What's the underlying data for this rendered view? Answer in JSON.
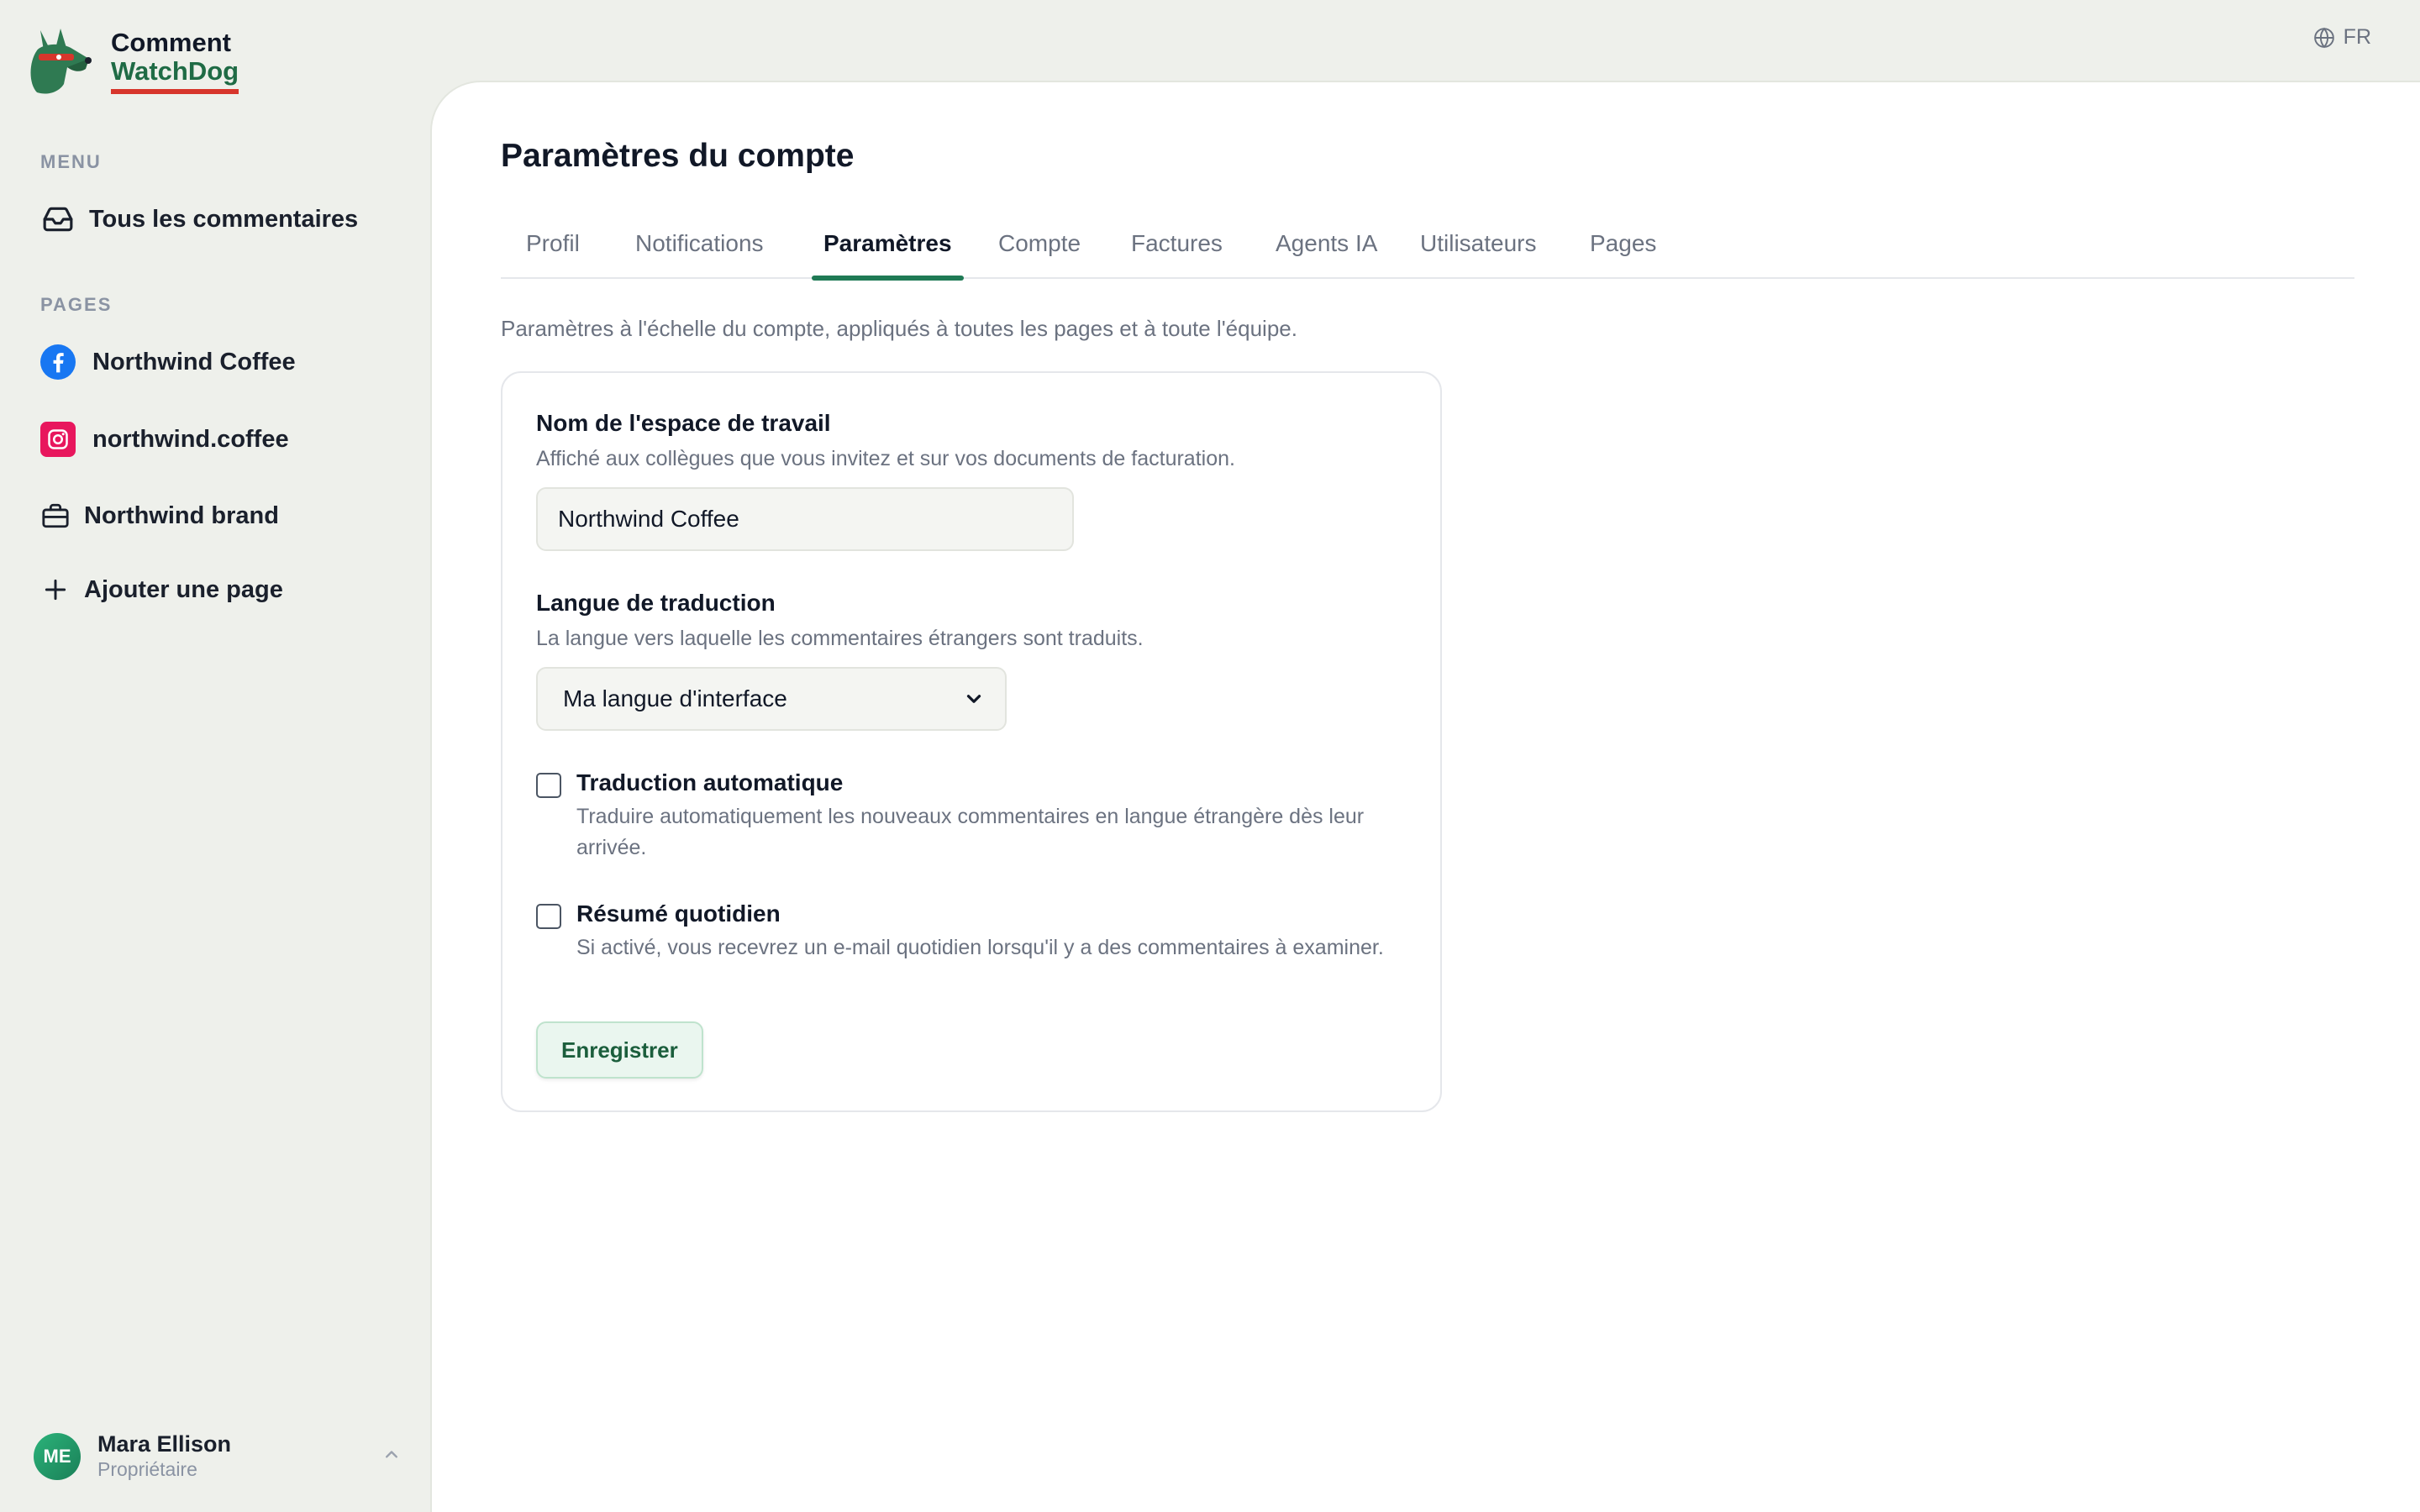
{
  "brand": {
    "line1": "Comment",
    "line2": "WatchDog",
    "accent": "#d7362c",
    "green": "#1f6b45"
  },
  "topbar": {
    "language": "FR",
    "language_icon": "globe-icon"
  },
  "sidebar": {
    "menu_label": "MENU",
    "menu_items": [
      {
        "label": "Tous les commentaires",
        "icon": "inbox-icon"
      }
    ],
    "pages_label": "PAGES",
    "pages": [
      {
        "label": "Northwind Coffee",
        "icon": "facebook-icon"
      },
      {
        "label": "northwind.coffee",
        "icon": "instagram-icon"
      },
      {
        "label": "Northwind brand",
        "icon": "briefcase-icon"
      },
      {
        "label": "Ajouter une page",
        "icon": "plus-icon"
      }
    ],
    "user": {
      "initials": "ME",
      "name": "Mara Ellison",
      "role": "Propriétaire"
    }
  },
  "main": {
    "title": "Paramètres du compte",
    "tabs": [
      {
        "label": "Profil",
        "active": false
      },
      {
        "label": "Notifications",
        "active": false
      },
      {
        "label": "Paramètres",
        "active": true
      },
      {
        "label": "Compte",
        "active": false
      },
      {
        "label": "Factures",
        "active": false
      },
      {
        "label": "Agents IA",
        "active": false
      },
      {
        "label": "Utilisateurs",
        "active": false
      },
      {
        "label": "Pages",
        "active": false
      }
    ],
    "intro": "Paramètres à l'échelle du compte, appliqués à toutes les pages et à toute l'équipe.",
    "form": {
      "workspace": {
        "label": "Nom de l'espace de travail",
        "help": "Affiché aux collègues que vous invitez et sur vos documents de facturation.",
        "value": "Northwind Coffee"
      },
      "translation_language": {
        "label": "Langue de traduction",
        "help": "La langue vers laquelle les commentaires étrangers sont traduits.",
        "selected": "Ma langue d'interface"
      },
      "auto_translate": {
        "label": "Traduction automatique",
        "help": "Traduire automatiquement les nouveaux commentaires en langue étrangère dès leur arrivée.",
        "checked": false
      },
      "daily_digest": {
        "label": "Résumé quotidien",
        "help": "Si activé, vous recevrez un e-mail quotidien lorsqu'il y a des commentaires à examiner.",
        "checked": false
      },
      "save_label": "Enregistrer"
    }
  }
}
